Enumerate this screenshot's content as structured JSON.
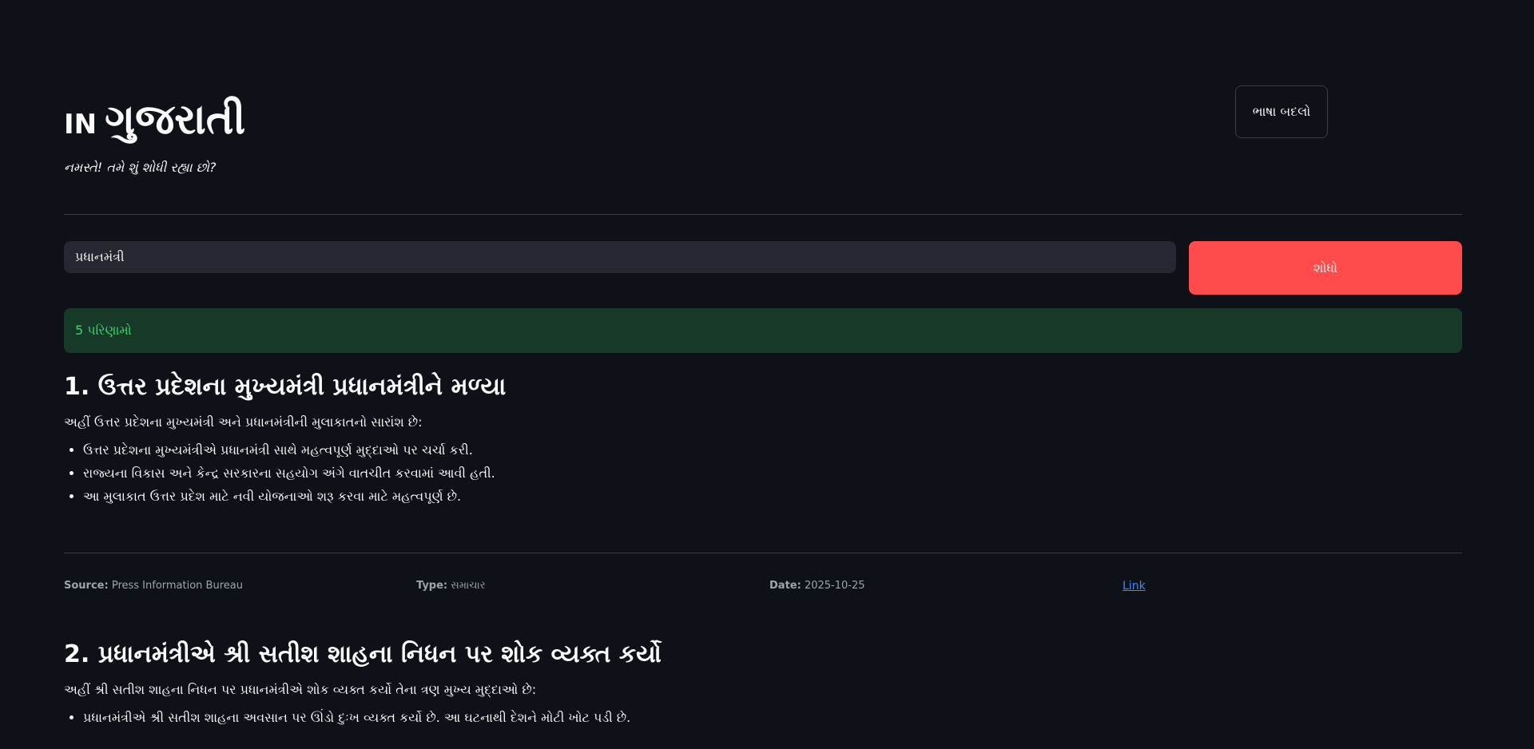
{
  "header": {
    "prefix": "IN",
    "title": "ગુજરાતી",
    "subtitle": "નમસ્તે! તમે શું શોધી રહ્યા છો?",
    "lang_button": "ભાષા બદલો"
  },
  "search": {
    "value": "પ્રધાનમંત્રી",
    "button": "શોધો"
  },
  "results_count": "5 પરિણામો",
  "results": [
    {
      "title": "1. ઉત્તર પ્રદેશના મુખ્યમંત્રી પ્રધાનમંત્રીને મળ્યા",
      "summary": "અહીં ઉત્તર પ્રદેશના મુખ્યમંત્રી અને પ્રધાનમંત્રીની મુલાકાતનો સારાંશ છે:",
      "bullets": [
        "ઉત્તર પ્રદેશના મુખ્યમંત્રીએ પ્રધાનમંત્રી સાથે મહત્વપૂર્ણ મુદ્દાઓ પર ચર્ચા કરી.",
        "રાજ્યના વિકાસ અને કેન્દ્ર સરકારના સહયોગ અંગે વાતચીત કરવામાં આવી હતી.",
        "આ મુલાકાત ઉત્તર પ્રદેશ માટે નવી યોજનાઓ શરૂ કરવા માટે મહત્વપૂર્ણ છે."
      ],
      "source_label": "Source:",
      "source": "Press Information Bureau",
      "type_label": "Type:",
      "type": "સમાચાર",
      "date_label": "Date:",
      "date": "2025-10-25",
      "link": "Link"
    },
    {
      "title": "2. પ્રધાનમંત્રીએ શ્રી સતીશ શાહના નિધન પર શોક વ્યક્ત કર્યો",
      "summary": "અહીં શ્રી સતીશ શાહના નિધન પર પ્રધાનમંત્રીએ શોક વ્યક્ત કર્યો તેના ત્રણ મુખ્ય મુદ્દાઓ છે:",
      "bullets": [
        "પ્રધાનમંત્રીએ શ્રી સતીશ શાહના અવસાન પર ઊંડો દુઃખ વ્યક્ત કર્યો છે. આ ઘટનાથી દેશને મોટી ખોટ પડી છે."
      ]
    }
  ]
}
